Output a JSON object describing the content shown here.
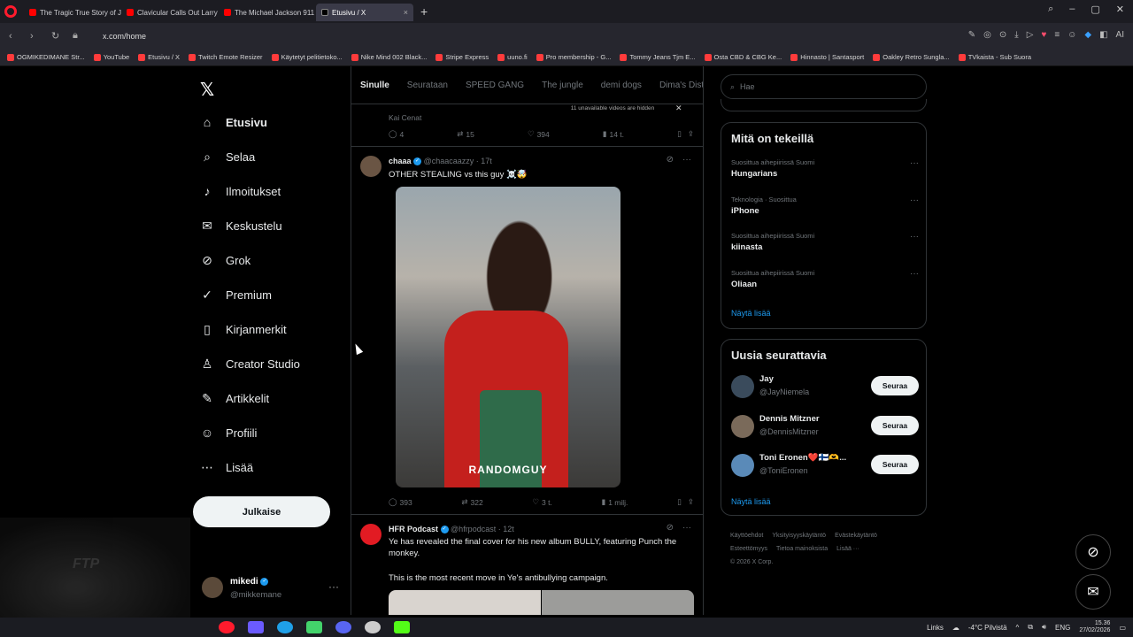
{
  "browser": {
    "tabs": [
      {
        "title": "The Tragic True Story of Ju",
        "active": false
      },
      {
        "title": "Clavicular Calls Out Larry",
        "active": false
      },
      {
        "title": "The Michael Jackson 911 C",
        "active": false
      },
      {
        "title": "Etusivu / X",
        "active": true
      }
    ],
    "url": "x.com/home",
    "bookmarks": [
      "OGMIKEDIMANE Str...",
      "YouTube",
      "Etusivu / X",
      "Twitch Emote Resizer",
      "Käytetyt pelitietoko...",
      "Nike Mind 002 Black...",
      "Stripe Express",
      "uuno.fi",
      "Pro membership - G...",
      "Tommy Jeans Tjm E...",
      "Osta CBD & CBG Ke...",
      "Hinnasto | Santasport",
      "Oakley Retro Sungla...",
      "TVkaista - Sub Suora"
    ],
    "ai_label": "AI"
  },
  "nav": {
    "items": [
      {
        "label": "Etusivu",
        "icon": "home-icon",
        "glyph": "⌂"
      },
      {
        "label": "Selaa",
        "icon": "search-icon",
        "glyph": "⌕"
      },
      {
        "label": "Ilmoitukset",
        "icon": "bell-icon",
        "glyph": "♪"
      },
      {
        "label": "Keskustelu",
        "icon": "mail-icon",
        "glyph": "✉"
      },
      {
        "label": "Grok",
        "icon": "grok-icon",
        "glyph": "⊘"
      },
      {
        "label": "Premium",
        "icon": "verified-icon",
        "glyph": "✓"
      },
      {
        "label": "Kirjanmerkit",
        "icon": "bookmark-icon",
        "glyph": "▯"
      },
      {
        "label": "Creator Studio",
        "icon": "creator-icon",
        "glyph": "♙"
      },
      {
        "label": "Artikkelit",
        "icon": "article-icon",
        "glyph": "✎"
      },
      {
        "label": "Profiili",
        "icon": "profile-icon",
        "glyph": "☺"
      },
      {
        "label": "Lisää",
        "icon": "more-icon",
        "glyph": "⋯"
      }
    ],
    "post_button": "Julkaise",
    "profile": {
      "name": "mikedi",
      "handle": "@mikkemane"
    }
  },
  "feed": {
    "tabs": [
      "Sinulle",
      "Seurataan",
      "SPEED GANG",
      "The jungle",
      "demi dogs",
      "Dima's Dist"
    ],
    "banner": "11 unavailable videos are hidden",
    "tweets": [
      {
        "partial_text": "Kai Cenat",
        "replies": "4",
        "reposts": "15",
        "likes": "394",
        "views": "14 t."
      },
      {
        "name": "chaaa",
        "handle": "@chaacaazzy · 17t",
        "text": "OTHER STEALING vs this guy ☠️🤯",
        "media_caption": "RANDOMGUY",
        "replies": "393",
        "reposts": "322",
        "likes": "3 t.",
        "views": "1 milj."
      },
      {
        "name": "HFR Podcast",
        "handle": "@hfrpodcast · 12t",
        "text": "Ye has revealed the final cover for his new album BULLY, featuring Punch the monkey.",
        "text2": "This is the most recent move in Ye's antibullying campaign."
      }
    ]
  },
  "sidebar": {
    "search_placeholder": "Hae",
    "trending_title": "Mitä on tekeillä",
    "trends": [
      {
        "context": "Suosittua aihepiirissä Suomi",
        "topic": "Hungarians"
      },
      {
        "context": "Teknologia · Suosittua",
        "topic": "iPhone"
      },
      {
        "context": "Suosittua aihepiirissä Suomi",
        "topic": "kiinasta"
      },
      {
        "context": "Suosittua aihepiirissä Suomi",
        "topic": "Oliaan"
      }
    ],
    "show_more": "Näytä lisää",
    "who_to_follow_title": "Uusia seurattavia",
    "follow": [
      {
        "name": "Jay",
        "handle": "@JayNiemela",
        "button": "Seuraa"
      },
      {
        "name": "Dennis Mitzner",
        "handle": "@DennisMitzner",
        "button": "Seuraa"
      },
      {
        "name": "Toni Eronen❤️🇫🇮🫶...",
        "handle": "@ToniEronen",
        "button": "Seuraa"
      }
    ],
    "footer": [
      "Käyttöehdot",
      "Yksityisyyskäytäntö",
      "Evästekäytäntö",
      "Esteettömyys",
      "Tietoa mainoksista",
      "Lisää ···",
      "© 2026 X Corp."
    ]
  },
  "taskbar": {
    "links": "Links",
    "weather": "-4°C  Pilvistä",
    "lang": "ENG",
    "time": "15.36",
    "date": "27/02/2026"
  },
  "overlay": {
    "webcam_text": "FTP"
  },
  "colors": {
    "accent": "#1d9bf0",
    "background": "#000000",
    "border": "#2f3336"
  }
}
